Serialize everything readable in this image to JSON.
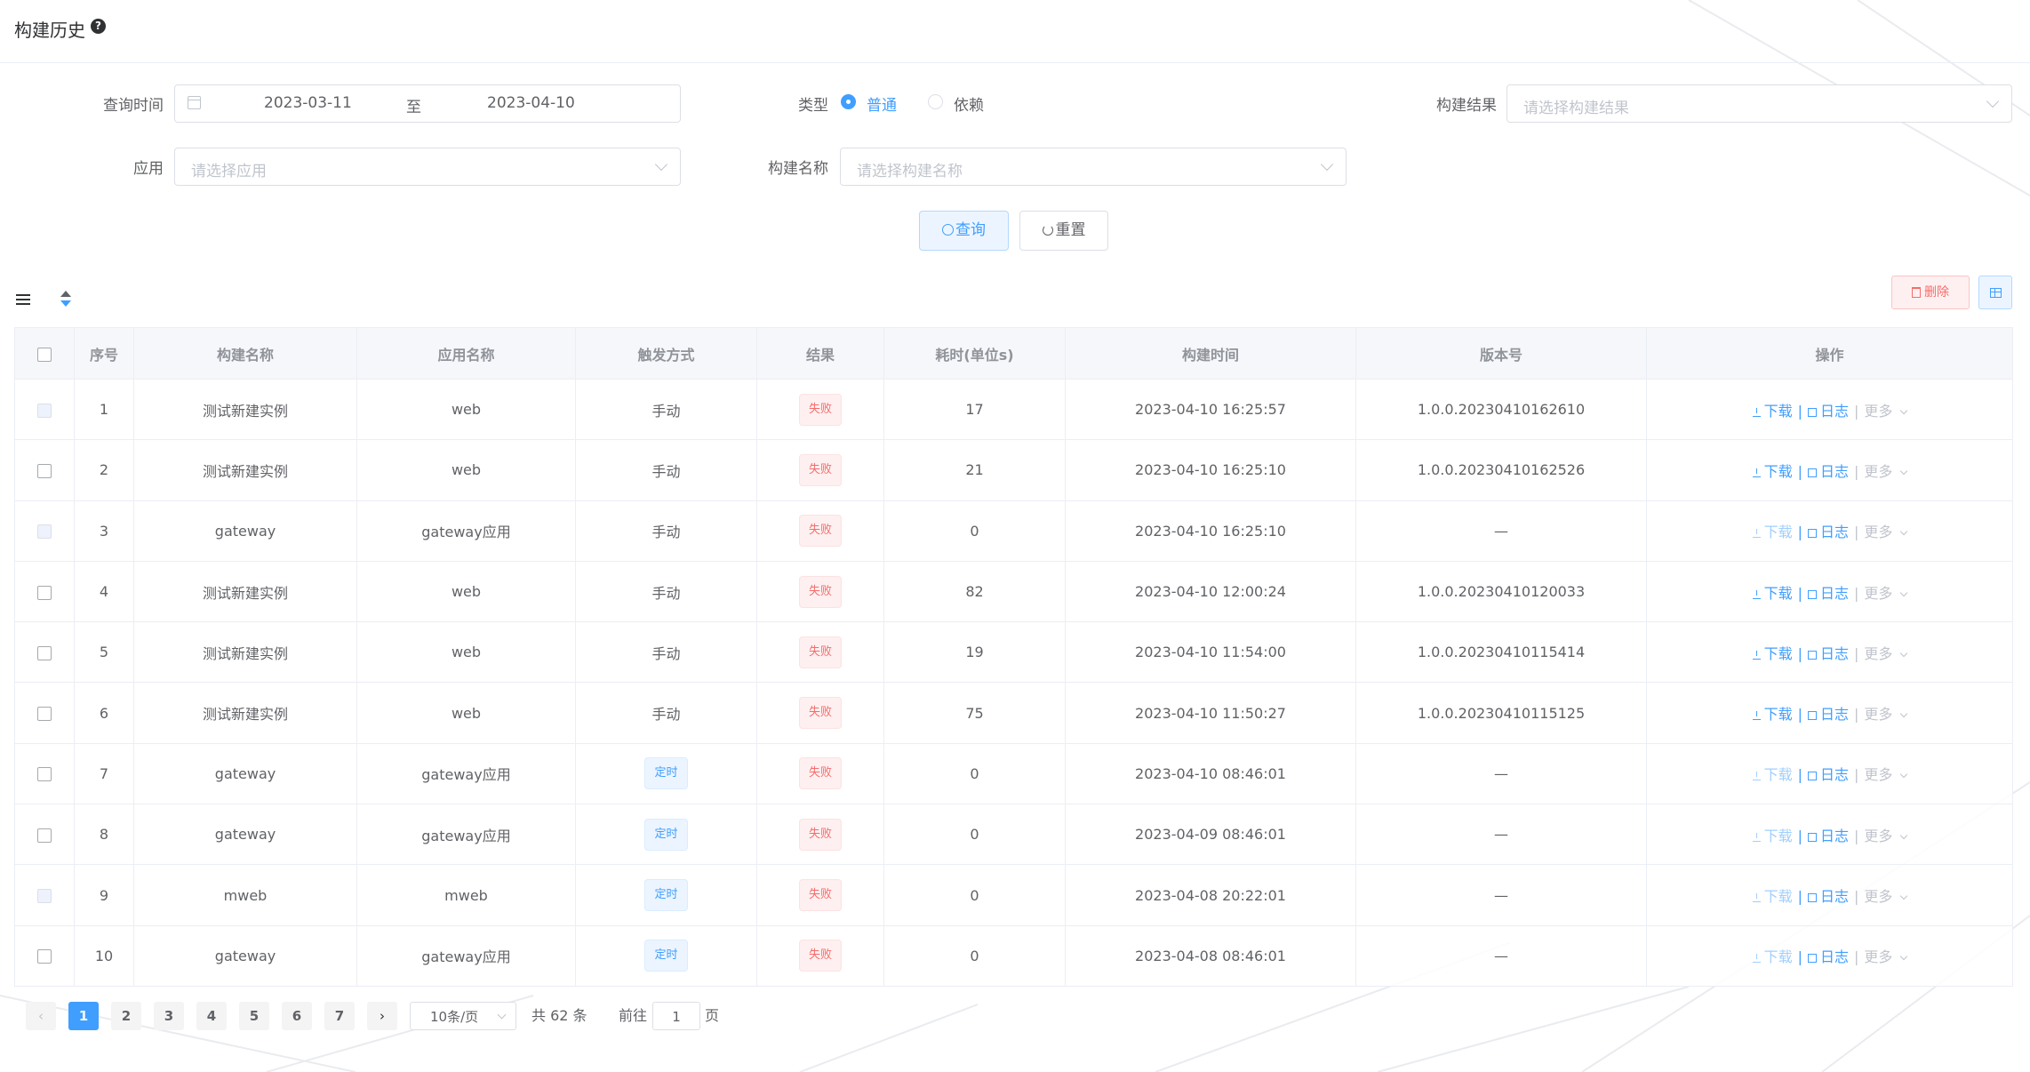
{
  "header": {
    "title": "构建历史"
  },
  "filters": {
    "query_time_label": "查询时间",
    "date_start": "2023-03-11",
    "date_separator": "至",
    "date_end": "2023-04-10",
    "type_label": "类型",
    "type_options": [
      "普通",
      "依赖"
    ],
    "type_selected": "普通",
    "result_label": "构建结果",
    "result_placeholder": "请选择构建结果",
    "app_label": "应用",
    "app_placeholder": "请选择应用",
    "build_name_label": "构建名称",
    "build_name_placeholder": "请选择构建名称",
    "query_button": "查询",
    "reset_button": "重置"
  },
  "toolbar": {
    "delete_button": "删除"
  },
  "table": {
    "columns": [
      "序号",
      "构建名称",
      "应用名称",
      "触发方式",
      "结果",
      "耗时(单位s)",
      "构建时间",
      "版本号",
      "操作"
    ],
    "op_labels": {
      "download": "下载",
      "log": "日志",
      "more": "更多"
    },
    "rows": [
      {
        "index": "1",
        "build_name": "测试新建实例",
        "app_name": "web",
        "trigger": "手动",
        "trigger_tag": false,
        "result": "失败",
        "duration": "17",
        "build_time": "2023-04-10 16:25:57",
        "version": "1.0.0.20230410162610",
        "checkbox_disabled": true,
        "download_enabled": true
      },
      {
        "index": "2",
        "build_name": "测试新建实例",
        "app_name": "web",
        "trigger": "手动",
        "trigger_tag": false,
        "result": "失败",
        "duration": "21",
        "build_time": "2023-04-10 16:25:10",
        "version": "1.0.0.20230410162526",
        "checkbox_disabled": false,
        "download_enabled": true
      },
      {
        "index": "3",
        "build_name": "gateway",
        "app_name": "gateway应用",
        "trigger": "手动",
        "trigger_tag": false,
        "result": "失败",
        "duration": "0",
        "build_time": "2023-04-10 16:25:10",
        "version": "—",
        "checkbox_disabled": true,
        "download_enabled": false
      },
      {
        "index": "4",
        "build_name": "测试新建实例",
        "app_name": "web",
        "trigger": "手动",
        "trigger_tag": false,
        "result": "失败",
        "duration": "82",
        "build_time": "2023-04-10 12:00:24",
        "version": "1.0.0.20230410120033",
        "checkbox_disabled": false,
        "download_enabled": true
      },
      {
        "index": "5",
        "build_name": "测试新建实例",
        "app_name": "web",
        "trigger": "手动",
        "trigger_tag": false,
        "result": "失败",
        "duration": "19",
        "build_time": "2023-04-10 11:54:00",
        "version": "1.0.0.20230410115414",
        "checkbox_disabled": false,
        "download_enabled": true
      },
      {
        "index": "6",
        "build_name": "测试新建实例",
        "app_name": "web",
        "trigger": "手动",
        "trigger_tag": false,
        "result": "失败",
        "duration": "75",
        "build_time": "2023-04-10 11:50:27",
        "version": "1.0.0.20230410115125",
        "checkbox_disabled": false,
        "download_enabled": true
      },
      {
        "index": "7",
        "build_name": "gateway",
        "app_name": "gateway应用",
        "trigger": "定时",
        "trigger_tag": true,
        "result": "失败",
        "duration": "0",
        "build_time": "2023-04-10 08:46:01",
        "version": "—",
        "checkbox_disabled": false,
        "download_enabled": false
      },
      {
        "index": "8",
        "build_name": "gateway",
        "app_name": "gateway应用",
        "trigger": "定时",
        "trigger_tag": true,
        "result": "失败",
        "duration": "0",
        "build_time": "2023-04-09 08:46:01",
        "version": "—",
        "checkbox_disabled": false,
        "download_enabled": false
      },
      {
        "index": "9",
        "build_name": "mweb",
        "app_name": "mweb",
        "trigger": "定时",
        "trigger_tag": true,
        "result": "失败",
        "duration": "0",
        "build_time": "2023-04-08 20:22:01",
        "version": "—",
        "checkbox_disabled": true,
        "download_enabled": false
      },
      {
        "index": "10",
        "build_name": "gateway",
        "app_name": "gateway应用",
        "trigger": "定时",
        "trigger_tag": true,
        "result": "失败",
        "duration": "0",
        "build_time": "2023-04-08 08:46:01",
        "version": "—",
        "checkbox_disabled": false,
        "download_enabled": false
      }
    ]
  },
  "pagination": {
    "pages": [
      "1",
      "2",
      "3",
      "4",
      "5",
      "6",
      "7"
    ],
    "current_page": "1",
    "page_size": "10条/页",
    "total": "共 62 条",
    "goto_prefix": "前往",
    "goto_value": "1",
    "goto_suffix": "页"
  },
  "colors": {
    "primary": "#409eff",
    "danger": "#f56c6c",
    "border": "#dcdfe6",
    "header_bg": "#f5f7fa"
  }
}
